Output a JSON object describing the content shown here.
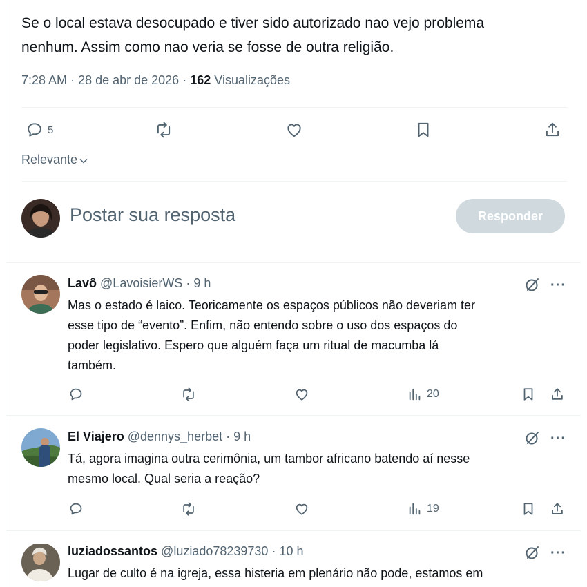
{
  "tweet": {
    "text_line1": "Se o local estava desocupado e tiver sido autorizado nao vejo problema",
    "text_line2": "nenhum. Assim como nao veria se fosse de outra religião.",
    "time": "7:28 AM",
    "date": "28 de abr de 2026",
    "views_count": "162",
    "views_label": "Visualizações",
    "reply_count": "5"
  },
  "sort": {
    "label": "Relevante"
  },
  "compose": {
    "placeholder": "Postar sua resposta",
    "button_label": "Responder"
  },
  "replies": [
    {
      "name": "Lavô",
      "handle": "@LavoisierWS",
      "time": "9 h",
      "lines": [
        "Mas o estado é laico. Teoricamente os espaços públicos não deveriam ter",
        "esse tipo de “evento”. Enfim, não entendo sobre o uso dos espaços do",
        "poder legislativo. Espero que alguém faça um ritual de macumba lá",
        "também."
      ],
      "views": "20"
    },
    {
      "name": "El Viajero",
      "handle": "@dennys_herbet",
      "time": "9 h",
      "lines": [
        "Tá, agora imagina outra cerimônia, um tambor africano batendo aí nesse",
        "mesmo local. Qual seria a reação?"
      ],
      "views": "19"
    },
    {
      "name": "luziadossantos",
      "handle": "@luziado78239730",
      "time": "10 h",
      "lines": [
        "Lugar de culto é na igreja, essa histeria em plenário não pode, estamos em"
      ]
    }
  ],
  "icons": {
    "reply": "comment-icon",
    "repost": "repost-icon",
    "like": "heart-icon",
    "bookmark": "bookmark-icon",
    "share": "share-icon",
    "views": "analytics-icon",
    "grok": "grok-icon",
    "more": "more-icon"
  },
  "colors": {
    "text": "#0f1419",
    "muted": "#536471",
    "border": "#eff3f4",
    "button_disabled": "#cfd9de"
  }
}
